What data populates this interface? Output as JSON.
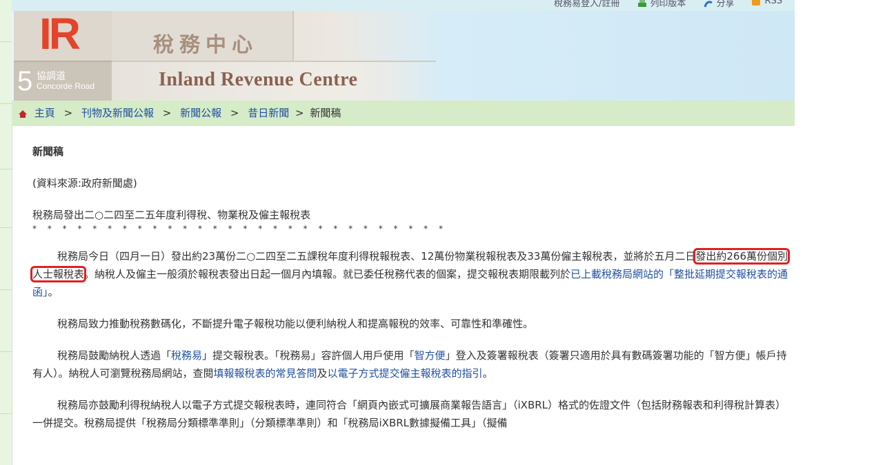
{
  "topbar": {
    "links": [
      {
        "label": "稅務易登入/註冊",
        "icon": "user-icon"
      },
      {
        "label": "列印版本",
        "icon": "printer-icon"
      },
      {
        "label": "分享",
        "icon": "share-icon"
      },
      {
        "label": "RSS",
        "icon": "rss-icon"
      }
    ]
  },
  "banner": {
    "logo_text": "IR",
    "cn_name": "稅務中心",
    "address_number": "5",
    "address_cn": "協調道",
    "address_en": "Concorde Road",
    "en_name": "Inland Revenue Centre"
  },
  "breadcrumb": {
    "items": [
      "主頁",
      "刊物及新聞公報",
      "新聞公報",
      "昔日新聞"
    ],
    "separator": ">",
    "current": "新聞稿"
  },
  "article": {
    "title": "新聞稿",
    "source": "(資料來源:政府新聞處)",
    "headline": "稅務局發出二○二四至二五年度利得稅、物業稅及僱主報稅表",
    "stars": "* * * * * * * * * * * * * * * * * * * * * * * * * * * *",
    "p1_a": "稅務局今日（四月一日）發出約23萬份二○二四至二五課稅年度利得稅報稅表、12萬份物業稅報稅表及33萬份僱主報稅表，並將於五月二日",
    "p1_highlight": "發出約266萬份個別人士報稅表",
    "p1_b": "。納稅人及僱主一般須於報稅表發出日起一個月內填報。就已委任稅務代表的個案，提交報稅表期限載列於",
    "p1_link": "已上載稅務局網站的「整批延期提交報稅表的通函」",
    "p1_c": "。",
    "p2": "稅務局致力推動稅務數碼化，不斷提升電子報稅功能以便利納稅人和提高報稅的效率、可靠性和準確性。",
    "p3_a": "稅務局鼓勵納稅人透過「",
    "p3_link1": "稅務易",
    "p3_b": "」提交報稅表。「稅務易」容許個人用戶使用「",
    "p3_link2": "智方便",
    "p3_c": "」登入及簽署報稅表（簽署只適用於具有數碼簽署功能的「智方便」帳戶持有人）。納稅人可瀏覽稅務局網站，查閱",
    "p3_link3": "填報報稅表的常見答問",
    "p3_d": "及",
    "p3_link4": "以電子方式提交僱主報稅表的指引",
    "p3_e": "。",
    "p4": "稅務局亦鼓勵利得稅納稅人以電子方式提交報稅表時，連同符合「網頁內嵌式可擴展商業報告語言」（iXBRL）格式的佐證文件（包括財務報表和利得稅計算表）一併提交。稅務局提供「稅務局分類標準準則」（分類標準準則）和「稅務局iXBRL數據擬備工具」（擬備"
  },
  "colors": {
    "breadcrumb_bg": "#d6ebc7",
    "link": "#1f4fa0",
    "highlight_border": "#e02020",
    "logo_red": "#e2452b"
  }
}
